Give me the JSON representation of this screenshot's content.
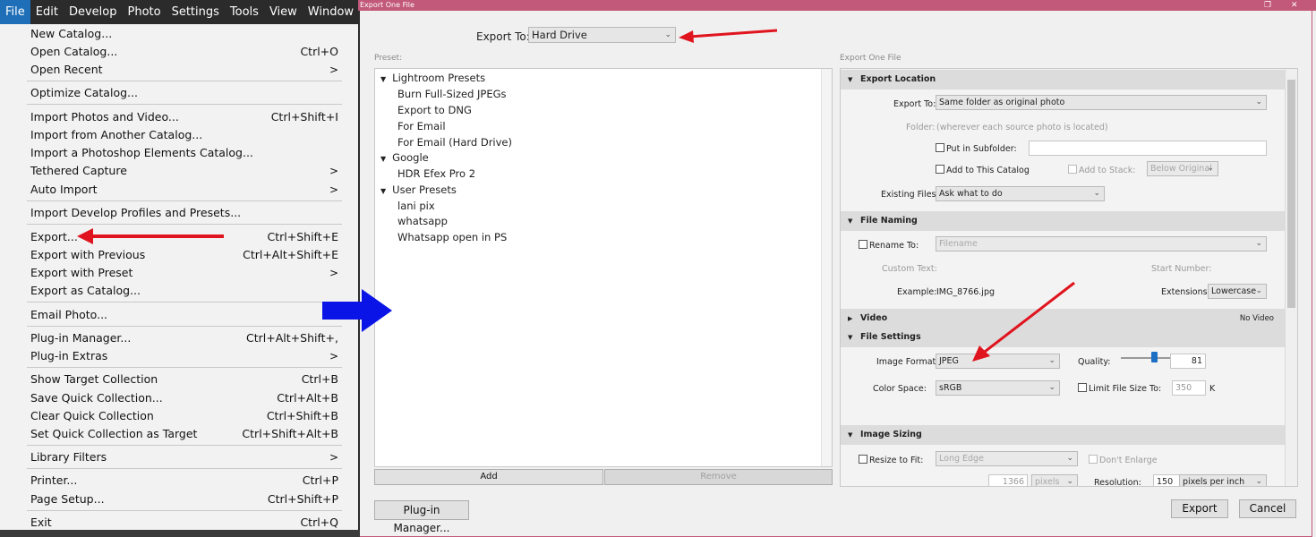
{
  "menubar": {
    "items": [
      "File",
      "Edit",
      "Develop",
      "Photo",
      "Settings",
      "Tools",
      "View",
      "Window",
      "He"
    ]
  },
  "file_menu": {
    "items": [
      {
        "label": "New Catalog...",
        "shortcut": ""
      },
      {
        "label": "Open Catalog...",
        "shortcut": "Ctrl+O"
      },
      {
        "label": "Open Recent",
        "submenu": ">"
      },
      {
        "label": "Optimize Catalog...",
        "shortcut": ""
      },
      {
        "label": "Import Photos and Video...",
        "shortcut": "Ctrl+Shift+I"
      },
      {
        "label": "Import from Another Catalog...",
        "shortcut": ""
      },
      {
        "label": "Import a Photoshop Elements Catalog...",
        "shortcut": ""
      },
      {
        "label": "Tethered Capture",
        "submenu": ">"
      },
      {
        "label": "Auto Import",
        "submenu": ">"
      },
      {
        "label": "Import Develop Profiles and Presets...",
        "shortcut": ""
      },
      {
        "label": "Export...",
        "shortcut": "Ctrl+Shift+E"
      },
      {
        "label": "Export with Previous",
        "shortcut": "Ctrl+Alt+Shift+E"
      },
      {
        "label": "Export with Preset",
        "submenu": ">"
      },
      {
        "label": "Export as Catalog...",
        "shortcut": ""
      },
      {
        "label": "Email Photo...",
        "shortcut": ""
      },
      {
        "label": "Plug-in Manager...",
        "shortcut": "Ctrl+Alt+Shift+,"
      },
      {
        "label": "Plug-in Extras",
        "submenu": ">"
      },
      {
        "label": "Show Target Collection",
        "shortcut": "Ctrl+B"
      },
      {
        "label": "Save Quick Collection...",
        "shortcut": "Ctrl+Alt+B"
      },
      {
        "label": "Clear Quick Collection",
        "shortcut": "Ctrl+Shift+B"
      },
      {
        "label": "Set Quick Collection as Target",
        "shortcut": "Ctrl+Shift+Alt+B"
      },
      {
        "label": "Library Filters",
        "submenu": ">"
      },
      {
        "label": "Printer...",
        "shortcut": "Ctrl+P"
      },
      {
        "label": "Page Setup...",
        "shortcut": "Ctrl+Shift+P"
      },
      {
        "label": "Exit",
        "shortcut": "Ctrl+Q"
      }
    ]
  },
  "dialog": {
    "title": "Export One File",
    "window_controls": {
      "restore": "❐",
      "close": "✕"
    },
    "export_to_label": "Export To:",
    "export_to_value": "Hard Drive",
    "preset_label": "Preset:",
    "settings_label": "Export One File",
    "presets": {
      "groups": [
        {
          "name": "Lightroom Presets",
          "items": [
            "Burn Full-Sized JPEGs",
            "Export to DNG",
            "For Email",
            "For Email (Hard Drive)"
          ]
        },
        {
          "name": "Google",
          "items": [
            "HDR Efex Pro 2"
          ]
        },
        {
          "name": "User Presets",
          "items": [
            "lani pix",
            "whatsapp",
            "Whatsapp open in PS"
          ]
        }
      ]
    },
    "buttons": {
      "add": "Add",
      "remove": "Remove",
      "plugin_manager": "Plug-in Manager...",
      "export": "Export",
      "cancel": "Cancel"
    },
    "export_location": {
      "header": "Export Location",
      "export_to_label": "Export To:",
      "export_to_value": "Same folder as original photo",
      "folder_label": "Folder:",
      "folder_value": "(wherever each source photo is located)",
      "subfolder_label": "Put in Subfolder:",
      "add_catalog_label": "Add to This Catalog",
      "add_stack_label": "Add to Stack:",
      "stack_value": "Below Original",
      "existing_label": "Existing Files:",
      "existing_value": "Ask what to do"
    },
    "file_naming": {
      "header": "File Naming",
      "rename_label": "Rename To:",
      "rename_value": "Filename",
      "custom_text_label": "Custom Text:",
      "start_number_label": "Start Number:",
      "example_label": "Example:",
      "example_value": "IMG_8766.jpg",
      "extensions_label": "Extensions:",
      "extensions_value": "Lowercase"
    },
    "video": {
      "header": "Video",
      "status": "No Video"
    },
    "file_settings": {
      "header": "File Settings",
      "format_label": "Image Format:",
      "format_value": "JPEG",
      "quality_label": "Quality:",
      "quality_value": "81",
      "quality_fraction": 0.81,
      "colorspace_label": "Color Space:",
      "colorspace_value": "sRGB",
      "limit_label": "Limit File Size To:",
      "limit_value": "350",
      "limit_unit": "K"
    },
    "image_sizing": {
      "header": "Image Sizing",
      "resize_label": "Resize to Fit:",
      "resize_value": "Long Edge",
      "dont_enlarge_label": "Don't Enlarge",
      "size_value": "1366",
      "size_unit": "pixels",
      "resolution_label": "Resolution:",
      "resolution_value": "150",
      "resolution_unit": "pixels per inch"
    }
  },
  "colors": {
    "titlebar": "#c2587a",
    "menu_active": "#1e6fb8",
    "annotation_red": "#e0141e",
    "annotation_blue": "#0a14e6"
  }
}
